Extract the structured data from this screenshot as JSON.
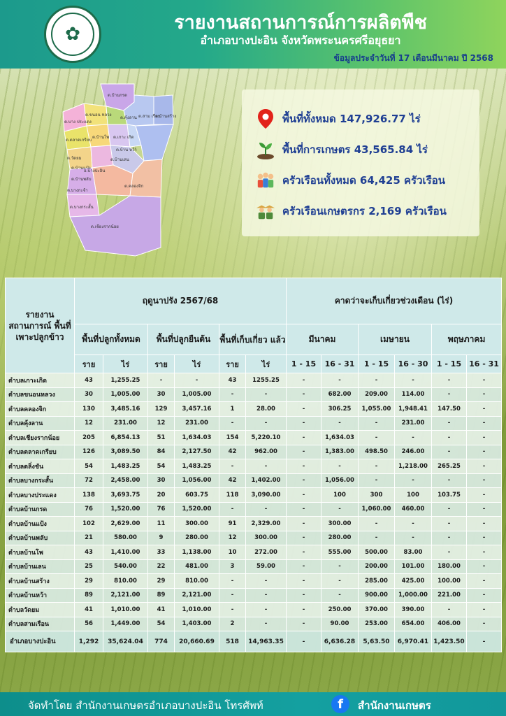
{
  "header": {
    "title": "รายงานสถานการณ์การผลิตพืช",
    "subtitle": "อำเภอบางปะอิน จังหวัดพระนครศรีอยุธยา",
    "date": "ข้อมูลประจำวันที่  17  เดือนมีนาคม ปี 2568",
    "logo_icon": "department-seal-icon"
  },
  "map": {
    "labels": [
      "ต.บ้านกรด",
      "ต.ขนอน หลวง",
      "ต.บาง ประแดง",
      "ต.คุ้งลาน",
      "ต.สาม เรือน",
      "ต.บ้านสร้าง",
      "ต.ตลาดเกรียบ",
      "ต.บ้านโพ",
      "ต.วัดยม",
      "ต.เกาะ เกิด",
      "ต.บ้าน หว้า",
      "ต.บ้านแป้ง",
      "ต.บ้านเลน",
      "ต.บ้านพลับ",
      "อ.บางปะอิน",
      "ต.บางกะจ้า",
      "ต.คลองจิก",
      "ต.บางกระสั้น",
      "ต.เชียงรากน้อย"
    ]
  },
  "info": {
    "total_area": "พื้นที่ทั้งหมด 147,926.77 ไร่",
    "agri_area": "พื้นที่การเกษตร 43,565.84 ไร่",
    "households": "ครัวเรือนทั้งหมด 64,425 ครัวเรือน",
    "farm_households": "ครัวเรือนเกษตรกร 2,169 ครัวเรือน",
    "icons": [
      "location-pin-icon",
      "seedling-icon",
      "family-icon",
      "farmers-icon"
    ]
  },
  "table": {
    "corner": "รายงาน สถานการณ์ พื้นที่ เพาะปลูกข้าว",
    "season": "ฤดูนาปรัง 2567/68",
    "forecast": "คาดว่าจะเก็บเกี่ยวช่วงเดือน (ไร่)",
    "col_total": "พื้นที่ปลูกทั้งหมด",
    "col_standing": "พื้นที่ปลูกยืนต้น",
    "col_harvested": "พื้นที่เก็บเกี่ยว แล้ว",
    "month1": "มีนาคม",
    "month2": "เมษายน",
    "month3": "พฤษภาคม",
    "u_rai": "ราย",
    "u_area": "ไร่",
    "p1": "1 - 15",
    "p2": "16 - 31",
    "p3": "1 - 15",
    "p4": "16 - 30",
    "p5": "1 - 15",
    "p6": "16 - 31",
    "rows": [
      [
        "ตำบลเกาะเกิด",
        "43",
        "1,255.25",
        "-",
        "-",
        "43",
        "1255.25",
        "-",
        "-",
        "-",
        "-",
        "-",
        "-"
      ],
      [
        "ตำบลขนอนหลวง",
        "30",
        "1,005.00",
        "30",
        "1,005.00",
        "-",
        "-",
        "-",
        "682.00",
        "209.00",
        "114.00",
        "-",
        "-"
      ],
      [
        "ตำบลคลองจิก",
        "130",
        "3,485.16",
        "129",
        "3,457.16",
        "1",
        "28.00",
        "-",
        "306.25",
        "1,055.00",
        "1,948.41",
        "147.50",
        "-"
      ],
      [
        "ตำบลคุ้งลาน",
        "12",
        "231.00",
        "12",
        "231.00",
        "-",
        "-",
        "-",
        "-",
        "-",
        "231.00",
        "-",
        "-"
      ],
      [
        "ตำบลเชียงรากน้อย",
        "205",
        "6,854.13",
        "51",
        "1,634.03",
        "154",
        "5,220.10",
        "-",
        "1,634.03",
        "-",
        "-",
        "-",
        "-"
      ],
      [
        "ตำบลตลาดเกรียบ",
        "126",
        "3,089.50",
        "84",
        "2,127.50",
        "42",
        "962.00",
        "-",
        "1,383.00",
        "498.50",
        "246.00",
        "-",
        "-"
      ],
      [
        "ตำบลตลิ่งชัน",
        "54",
        "1,483.25",
        "54",
        "1,483.25",
        "-",
        "-",
        "-",
        "-",
        "-",
        "1,218.00",
        "265.25",
        "-"
      ],
      [
        "ตำบลบางกระสั้น",
        "72",
        "2,458.00",
        "30",
        "1,056.00",
        "42",
        "1,402.00",
        "-",
        "1,056.00",
        "-",
        "-",
        "-",
        "-"
      ],
      [
        "ตำบลบางประแดง",
        "138",
        "3,693.75",
        "20",
        "603.75",
        "118",
        "3,090.00",
        "-",
        "100",
        "300",
        "100",
        "103.75",
        "-"
      ],
      [
        "ตำบลบ้านกรด",
        "76",
        "1,520.00",
        "76",
        "1,520.00",
        "-",
        "-",
        "-",
        "-",
        "1,060.00",
        "460.00",
        "-",
        "-"
      ],
      [
        "ตำบลบ้านแป้ง",
        "102",
        "2,629.00",
        "11",
        "300.00",
        "91",
        "2,329.00",
        "-",
        "300.00",
        "-",
        "-",
        "-",
        "-"
      ],
      [
        "ตำบลบ้านพลับ",
        "21",
        "580.00",
        "9",
        "280.00",
        "12",
        "300.00",
        "-",
        "280.00",
        "-",
        "-",
        "-",
        "-"
      ],
      [
        "ตำบลบ้านโพ",
        "43",
        "1,410.00",
        "33",
        "1,138.00",
        "10",
        "272.00",
        "-",
        "555.00",
        "500.00",
        "83.00",
        "-",
        "-"
      ],
      [
        "ตำบลบ้านเลน",
        "25",
        "540.00",
        "22",
        "481.00",
        "3",
        "59.00",
        "-",
        "-",
        "200.00",
        "101.00",
        "180.00",
        "-"
      ],
      [
        "ตำบลบ้านสร้าง",
        "29",
        "810.00",
        "29",
        "810.00",
        "-",
        "-",
        "-",
        "-",
        "285.00",
        "425.00",
        "100.00",
        "-"
      ],
      [
        "ตำบลบ้านหว้า",
        "89",
        "2,121.00",
        "89",
        "2,121.00",
        "-",
        "-",
        "-",
        "-",
        "900.00",
        "1,000.00",
        "221.00",
        "-"
      ],
      [
        "ตำบลวัดยม",
        "41",
        "1,010.00",
        "41",
        "1,010.00",
        "-",
        "-",
        "-",
        "250.00",
        "370.00",
        "390.00",
        "-",
        "-"
      ],
      [
        "ตำบลสามเรือน",
        "56",
        "1,449.00",
        "54",
        "1,403.00",
        "2",
        "-",
        "-",
        "90.00",
        "253.00",
        "654.00",
        "406.00",
        "-"
      ]
    ],
    "total": [
      "อำเภอบางปะอิน",
      "1,292",
      "35,624.04",
      "774",
      "20,660.69",
      "518",
      "14,963.35",
      "-",
      "6,636.28",
      "5,63.50",
      "6,970.41",
      "1,423.50",
      "-"
    ]
  },
  "footer": {
    "text": "จัดทำโดย สำนักงานเกษตรอำเภอบางปะอิน  โทรศัพท์",
    "fb_glyph": "f",
    "right": "สำนักงานเกษตร"
  },
  "colors": {
    "header_start": "#1c9a8c",
    "header_end": "#8fd45c",
    "info_text": "#1f3f93",
    "footer": "#0d8e8b",
    "table_header": "#cfe9e9"
  }
}
